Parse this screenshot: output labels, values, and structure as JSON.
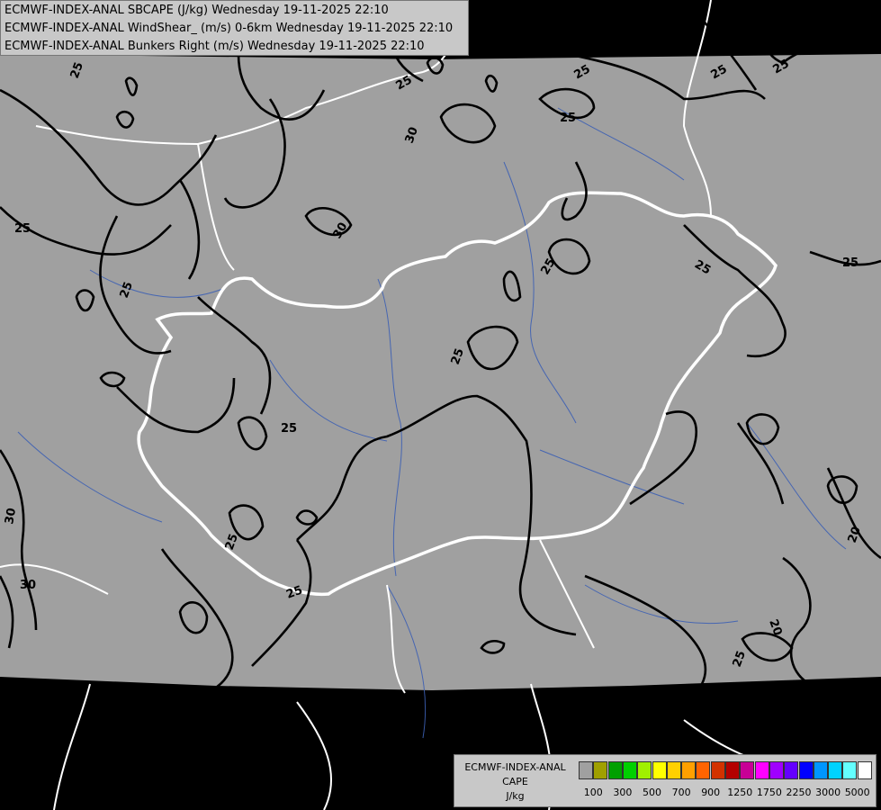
{
  "header": {
    "line1": "ECMWF-INDEX-ANAL SBCAPE (J/kg) Wednesday 19-11-2025 22:10",
    "line2": "ECMWF-INDEX-ANAL WindShear_ (m/s) 0-6km Wednesday 19-11-2025 22:10",
    "line3": "ECMWF-INDEX-ANAL Bunkers Right (m/s) Wednesday 19-11-2025 22:10"
  },
  "legend": {
    "title_line1": "ECMWF-INDEX-ANAL",
    "title_line2": "CAPE",
    "title_line3": "J/kg",
    "colors": [
      "#a0a0a0",
      "#a0a000",
      "#00a000",
      "#00d000",
      "#a0f000",
      "#ffff00",
      "#ffd000",
      "#ffa000",
      "#ff6400",
      "#d23200",
      "#b40000",
      "#c80096",
      "#ff00ff",
      "#a000ff",
      "#6400ff",
      "#0000ff",
      "#0096ff",
      "#00d2ff",
      "#64ffff",
      "#ffffff"
    ],
    "tick_labels": [
      "100",
      "300",
      "500",
      "700",
      "900",
      "1250",
      "1750",
      "2250",
      "3000",
      "5000"
    ]
  },
  "contour_labels": [
    {
      "text": "25"
    },
    {
      "text": "25"
    },
    {
      "text": "25"
    },
    {
      "text": "25"
    },
    {
      "text": "25"
    },
    {
      "text": "30"
    },
    {
      "text": "30"
    },
    {
      "text": "25"
    },
    {
      "text": "25"
    },
    {
      "text": "25"
    },
    {
      "text": "25"
    },
    {
      "text": "25"
    },
    {
      "text": "25"
    },
    {
      "text": "25"
    },
    {
      "text": "25"
    },
    {
      "text": "30"
    },
    {
      "text": "30"
    },
    {
      "text": "25"
    },
    {
      "text": "20"
    },
    {
      "text": "20"
    },
    {
      "text": "25"
    },
    {
      "text": "25"
    }
  ]
}
